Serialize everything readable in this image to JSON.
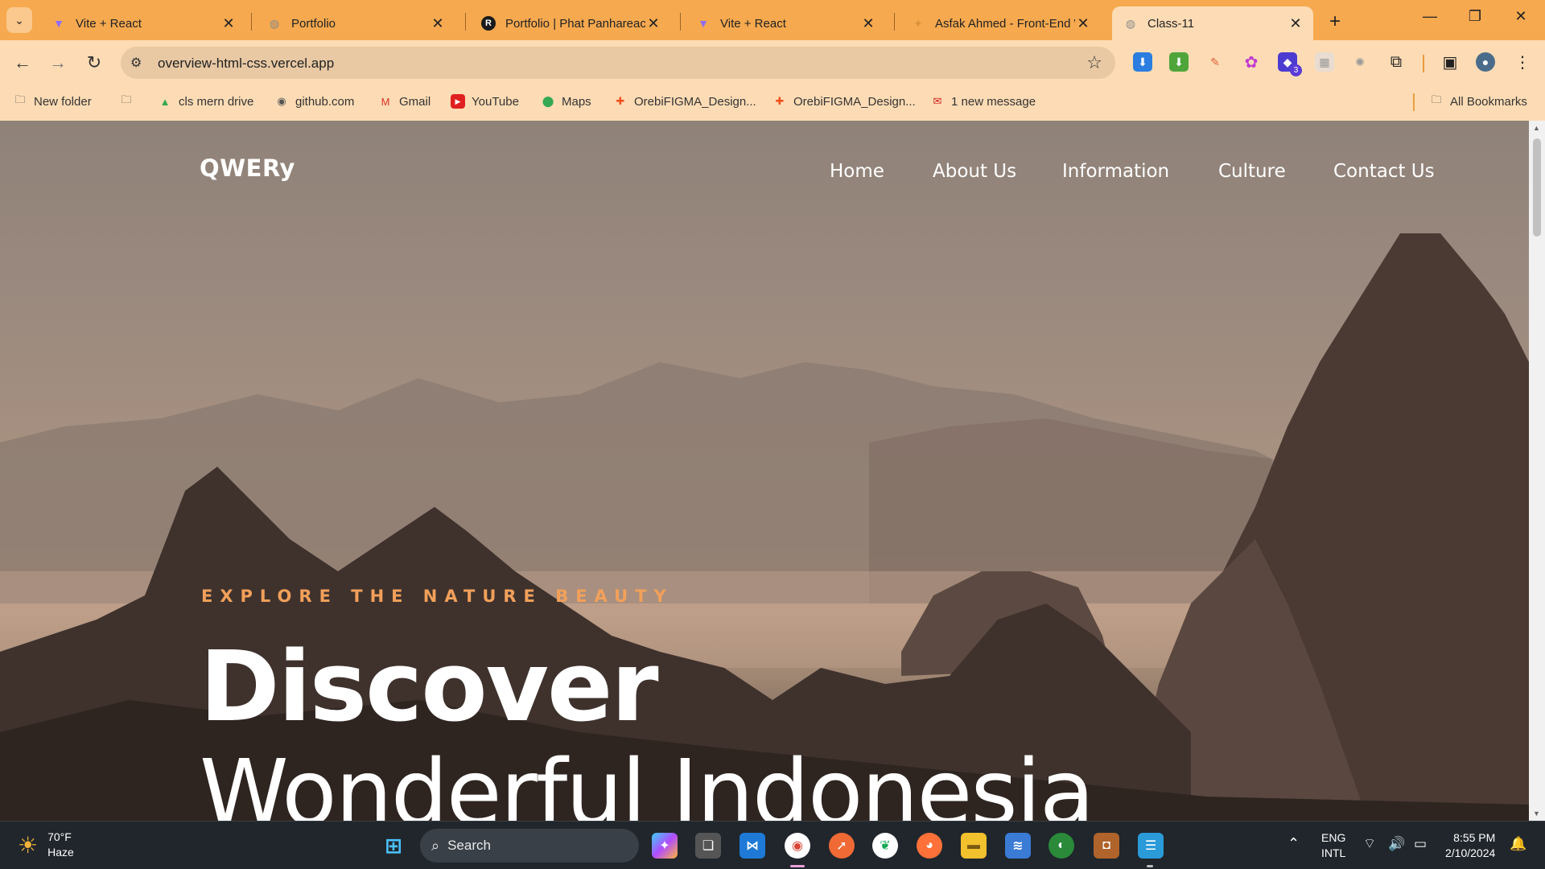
{
  "browser": {
    "tabs": [
      {
        "title": "Vite + React",
        "favicon": "vite-icon",
        "color": "#8f6cff"
      },
      {
        "title": "Portfolio",
        "favicon": "globe-icon",
        "color": "#8a8a8a"
      },
      {
        "title": "Portfolio | Phat Panhareach",
        "favicon": "r-logo-icon",
        "color": "#1a1a1a"
      },
      {
        "title": "Vite + React",
        "favicon": "vite-icon",
        "color": "#8f6cff"
      },
      {
        "title": "Asfak Ahmed - Front-End W",
        "favicon": "bird-icon",
        "color": "#d9923b"
      },
      {
        "title": "Class-11",
        "favicon": "globe-icon",
        "color": "#8a8a8a"
      }
    ],
    "url": "overview-html-css.vercel.app",
    "bookmarks": [
      {
        "label": "New folder",
        "icon": "folder-icon"
      },
      {
        "label": "",
        "icon": "folder-icon"
      },
      {
        "label": "cls mern drive",
        "icon": "google-drive-icon"
      },
      {
        "label": "github.com",
        "icon": "github-icon"
      },
      {
        "label": "Gmail",
        "icon": "gmail-icon"
      },
      {
        "label": "YouTube",
        "icon": "youtube-icon"
      },
      {
        "label": "Maps",
        "icon": "maps-icon"
      },
      {
        "label": "OrebiFIGMA_Design...",
        "icon": "figma-icon"
      },
      {
        "label": "OrebiFIGMA_Design...",
        "icon": "figma-icon"
      },
      {
        "label": "1 new message",
        "icon": "message-icon"
      }
    ],
    "all_bookmarks": "All Bookmarks",
    "extension_badge": "3"
  },
  "site": {
    "brand": "QWERy",
    "nav": [
      "Home",
      "About Us",
      "Information",
      "Culture",
      "Contact Us"
    ],
    "tagline": "EXPLORE THE NATURE BEAUTY",
    "heading": "Discover",
    "subheading": "Wonderful Indonesia",
    "accent": "#f2a05a"
  },
  "taskbar": {
    "weather_temp": "70°F",
    "weather_desc": "Haze",
    "search_label": "Search",
    "lang_top": "ENG",
    "lang_bottom": "INTL",
    "time": "8:55 PM",
    "date": "2/10/2024"
  }
}
